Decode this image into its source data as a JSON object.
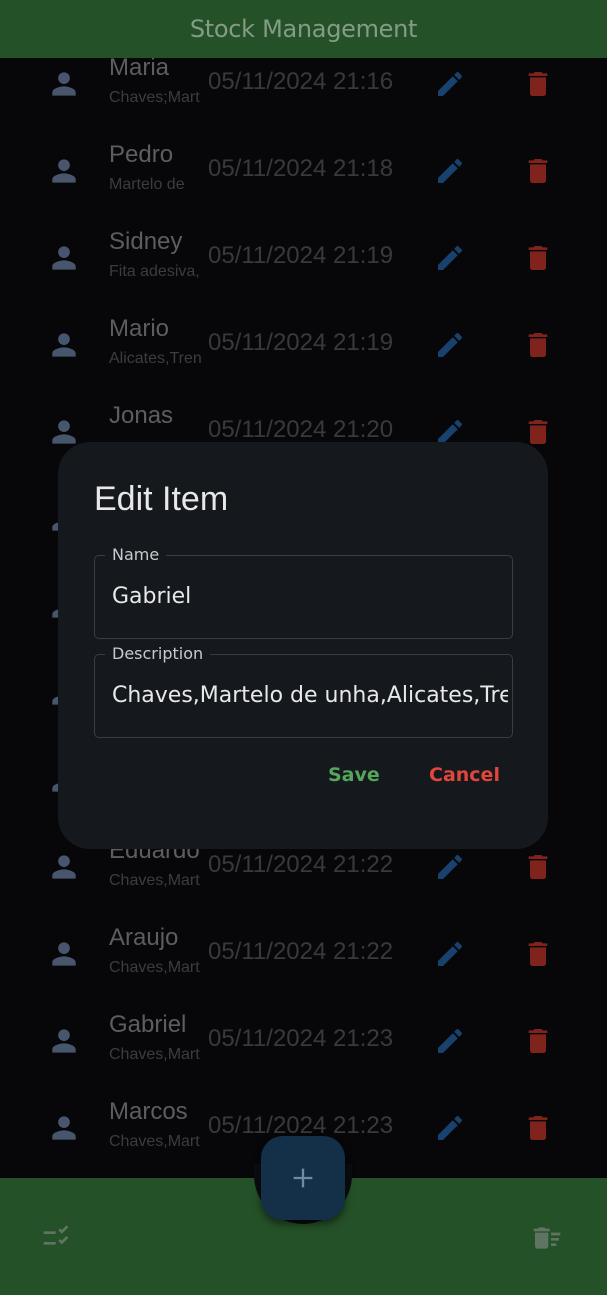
{
  "app": {
    "title": "Stock Management"
  },
  "colors": {
    "brand": "#245128",
    "edit": "#2565a8",
    "delete": "#c3372c",
    "save": "#55a55a",
    "cancel": "#e0463a",
    "fab": "#133048"
  },
  "rows": [
    {
      "name": "Maria",
      "desc": "Chaves;Mart",
      "date": "05/11/2024 21:16"
    },
    {
      "name": "Pedro",
      "desc": "Martelo de",
      "date": "05/11/2024 21:18"
    },
    {
      "name": "Sidney",
      "desc": "Fita adesiva,",
      "date": "05/11/2024 21:19"
    },
    {
      "name": "Mario",
      "desc": "Alicates,Tren",
      "date": "05/11/2024 21:19"
    },
    {
      "name": "Jonas",
      "desc": "",
      "date": "05/11/2024 21:20"
    },
    {
      "name": "",
      "desc": "",
      "date": ""
    },
    {
      "name": "",
      "desc": "",
      "date": ""
    },
    {
      "name": "",
      "desc": "",
      "date": ""
    },
    {
      "name": "",
      "desc": "",
      "date": ""
    },
    {
      "name": "Eduardo",
      "desc": "Chaves,Mart",
      "date": "05/11/2024 21:22"
    },
    {
      "name": "Araujo",
      "desc": "Chaves,Mart",
      "date": "05/11/2024 21:22"
    },
    {
      "name": "Gabriel",
      "desc": "Chaves,Mart",
      "date": "05/11/2024 21:23"
    },
    {
      "name": "Marcos",
      "desc": "Chaves,Mart",
      "date": "05/11/2024 21:23"
    }
  ],
  "dialog": {
    "title": "Edit Item",
    "name_label": "Name",
    "name_value": "Gabriel",
    "description_label": "Description",
    "description_value": "Chaves,Martelo de unha,Alicates,Trena",
    "save_label": "Save",
    "cancel_label": "Cancel"
  },
  "fab": {
    "icon": "plus-icon"
  },
  "bottom_bar": {
    "left_icon": "checklist-icon",
    "right_icon": "delete-sweep-icon"
  }
}
